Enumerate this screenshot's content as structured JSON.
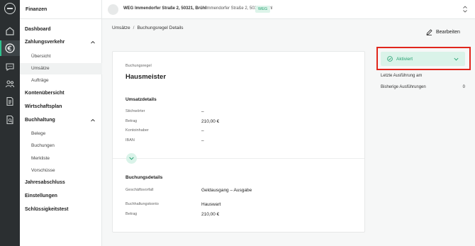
{
  "sidebar": {
    "header": "Finanzen",
    "items": {
      "dashboard": "Dashboard",
      "zahlungsverkehr": "Zahlungsverkehr",
      "uebersicht": "Übersicht",
      "umsaetze": "Umsätze",
      "auftraege": "Aufträge",
      "kontenuebersicht": "Kontenübersicht",
      "wirtschaftsplan": "Wirtschaftsplan",
      "buchhaltung": "Buchhaltung",
      "belege": "Belege",
      "buchungen": "Buchungen",
      "merkliste": "Merkliste",
      "vorschuesse": "Vorschüsse",
      "jahresabschluss": "Jahresabschluss",
      "einstellungen": "Einstellungen",
      "schluessigkeitstest": "Schlüssigkeitstest"
    }
  },
  "topbar": {
    "name": "WEG Immendorfer Straße 2, 50321, Brühl",
    "address": "Immendorfer Straße 2, 50321 Brühl",
    "badge": "WEG"
  },
  "breadcrumb": {
    "parent": "Umsätze",
    "separator": "/",
    "current": "Buchungsregel Details"
  },
  "actions": {
    "edit": "Bearbeiten"
  },
  "card": {
    "rule_label": "Buchungsregel",
    "rule_title": "Hausmeister",
    "umsatz_title": "Umsatzdetails",
    "umsatz_fields": [
      {
        "label": "Stichwörter",
        "value": "–"
      },
      {
        "label": "Betrag",
        "value": "210,00 €"
      },
      {
        "label": "Kontoinhaber",
        "value": "–"
      },
      {
        "label": "IBAN",
        "value": "–"
      }
    ],
    "buchung_title": "Buchungsdetails",
    "buchung_fields": [
      {
        "label": "Geschäftsvorfall",
        "value": "Geldausgang – Ausgabe"
      },
      {
        "label": "Buchhaltungskonto",
        "value": "Hauswart"
      },
      {
        "label": "Betrag",
        "value": "210,00 €"
      }
    ]
  },
  "status": {
    "selected": "Aktiviert",
    "last_run_label": "Letzte Ausführung am",
    "last_run_value": "",
    "previous_runs_label": "Bisherige Ausführungen",
    "previous_runs_value": "0"
  },
  "colors": {
    "accent": "#23a070",
    "accent_bg": "#daf3e9",
    "highlight": "#e0261c",
    "rail": "#2b2f31"
  }
}
